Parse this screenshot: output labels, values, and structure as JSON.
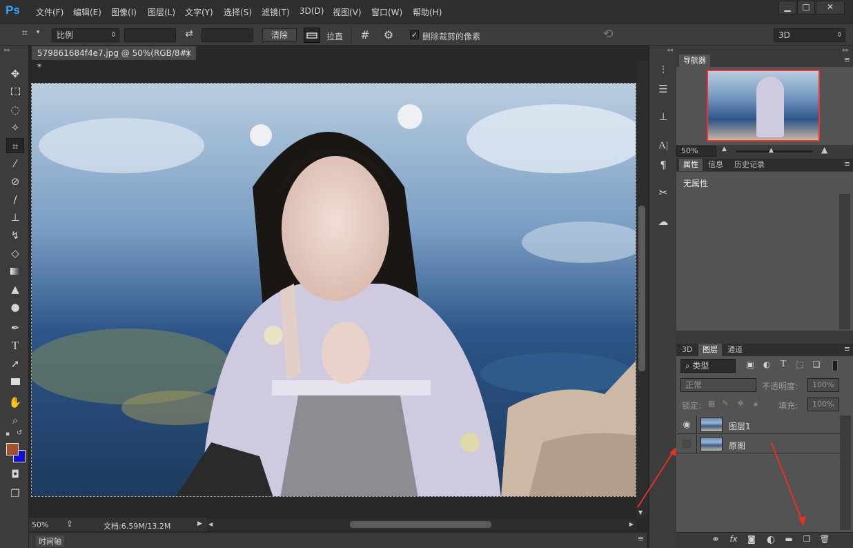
{
  "app": {
    "logo": "Ps"
  },
  "menu": [
    "文件(F)",
    "编辑(E)",
    "图像(I)",
    "图层(L)",
    "文字(Y)",
    "选择(S)",
    "滤镜(T)",
    "3D(D)",
    "视图(V)",
    "窗口(W)",
    "帮助(H)"
  ],
  "window_controls": {
    "minimize": "▁",
    "maximize": "□",
    "close": "✕"
  },
  "options": {
    "ratio_select": "比例",
    "width_value": "",
    "height_value": "",
    "swap_icon": "⇄",
    "clear_label": "清除",
    "straighten_label": "拉直",
    "delete_cropped_label": "删除裁剪的像素",
    "delete_cropped_checked": true,
    "workspace_select": "3D"
  },
  "document": {
    "tab_title": "579861684f4e7.jpg @ 50%(RGB/8#) *",
    "tab_close": "×",
    "zoom": "50%",
    "doc_info": "文档:6.59M/13.2M"
  },
  "timeline": {
    "label": "时间轴"
  },
  "navigator": {
    "tab": "导航器",
    "zoom": "50%"
  },
  "properties": {
    "tabs": [
      "属性",
      "信息",
      "历史记录"
    ],
    "content": "无属性"
  },
  "layers_panel": {
    "tabs": [
      "3D",
      "图层",
      "通道"
    ],
    "filter_type": "类型",
    "blend_mode": "正常",
    "opacity_label": "不透明度:",
    "opacity_value": "100%",
    "lock_label": "锁定:",
    "fill_label": "填充:",
    "fill_value": "100%",
    "layers": [
      {
        "name": "图层1",
        "visible": true
      },
      {
        "name": "原图",
        "visible": false
      }
    ]
  },
  "colors": {
    "accent": "#31a8ff",
    "foreground": "#a0522d",
    "background": "#1010d0",
    "annotation": "#e8321e"
  }
}
